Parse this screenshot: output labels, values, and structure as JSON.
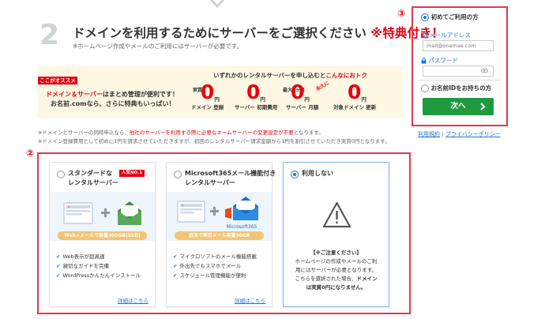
{
  "header": {
    "step_number": "2",
    "title": "ドメインを利用するためにサーバーをご選択ください",
    "title_highlight": "※特典付き！",
    "subtitle": "※ホームページ作成やメールのご利用にはサーバーが必要です。"
  },
  "banner": {
    "tag": "ここがオススメ",
    "line1_red": "ドメイン＆サーバー",
    "line1_rest": "はまとめ管理が便利です！",
    "line2": "お名前.comなら、さらに特典もいっぱい！",
    "title_prefix": "いずれかのレンタルサーバーを申し込むと",
    "title_red": "こんなにおトク",
    "stamp": "永久に",
    "prices": [
      {
        "prefix": "実質",
        "value": "0",
        "unit": "円",
        "label": "ドメイン 登録"
      },
      {
        "prefix": "",
        "value": "0",
        "unit": "円",
        "label": "サーバー 初期費用"
      },
      {
        "prefix": "最大2ヶ月",
        "value": "0",
        "unit": "円",
        "label": "サーバー 月額"
      },
      {
        "prefix": "",
        "value": "0",
        "unit": "円",
        "label": "対象ドメイン 更新"
      }
    ]
  },
  "notes": {
    "line1_pre": "※ドメインとサーバーの同時申込なら、",
    "line1_red": "他社のサーバーを利用する際に必要なネームサーバーの変更設定が不要",
    "line1_post": "となります。",
    "line2": "※ドメイン登録費用として初めに1円を請求させていただきますが、初回のレンタルサーバー請求金額から1円を割引させていただき実質0円となります。"
  },
  "markers": {
    "login": "③",
    "plans": "②"
  },
  "login": {
    "first_time_label": "初めてご利用の方",
    "email_label": "メールアドレス",
    "email_placeholder": "mail@onamae.com",
    "password_label": "パスワード",
    "password_placeholder": "",
    "existing_label": "お名前IDをお持ちの方",
    "next_label": "次へ",
    "terms_link": "利用規約",
    "privacy_link": "プライバシーポリシー"
  },
  "plans": [
    {
      "title_line1": "スタンダードな",
      "title_line2": "レンタルサーバー",
      "badge": "人気NO.1",
      "pill": "Web+メールで容量300GB(SSD)",
      "features": [
        "Web表示が超高速",
        "親切なガイドを完備",
        "WordPressかんたんインストール"
      ],
      "detail_link": "詳細はこちら"
    },
    {
      "title_line1": "Microsoft365メール機能付き",
      "title_line2": "レンタルサーバー",
      "brand": "Microsoft365",
      "pill": "追加で専用メール容量50GB",
      "features": [
        "マイクロソフトのメール機能搭載",
        "外出先でもスマホでメール",
        "スケジュール管理機能が便利"
      ],
      "detail_link": "詳細はこちら"
    },
    {
      "title_line1": "利用しない",
      "caution_title": "【※ご注意ください】",
      "caution_lines": [
        "ホームページの作成やメールのご利",
        "用にはサーバーが必要となります。",
        "こちらを選択された場合、"
      ],
      "caution_bold1": "ドメイン",
      "caution_bold2": "は実質0円になりません。"
    }
  ],
  "colors": {
    "accent_red": "#e60012",
    "link_blue": "#1a7ad4",
    "next_green": "#1f9a3e",
    "outline_red": "#e03a4e"
  }
}
